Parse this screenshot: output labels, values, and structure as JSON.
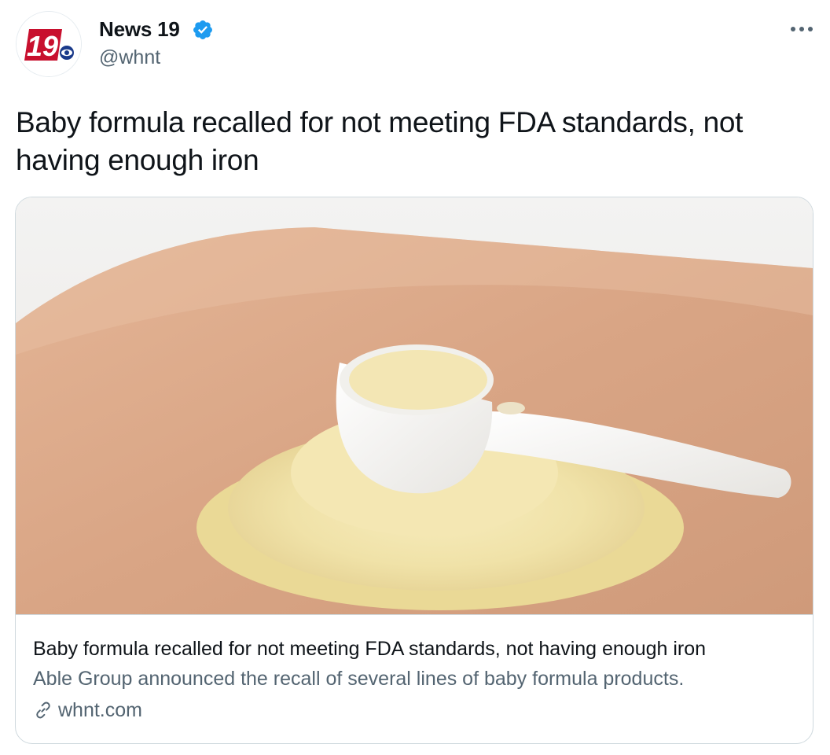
{
  "author": {
    "name": "News 19",
    "handle": "@whnt",
    "avatar_logo_text": "19",
    "verified_color": "#1d9bf0"
  },
  "menu": {
    "more_icon": "ellipsis-icon"
  },
  "tweet": {
    "text": "Baby formula recalled for not meeting FDA standards, not having enough iron"
  },
  "card": {
    "image_description_icon": "photo",
    "title": "Baby formula recalled for not meeting FDA standards, not having enough iron",
    "description": "Able Group announced the recall of several lines of baby formula products.",
    "domain": "whnt.com",
    "domain_icon": "link-icon"
  },
  "colors": {
    "text_primary": "#0f1419",
    "text_secondary": "#536471",
    "border": "#cfd9de",
    "logo_red": "#c8102e"
  }
}
